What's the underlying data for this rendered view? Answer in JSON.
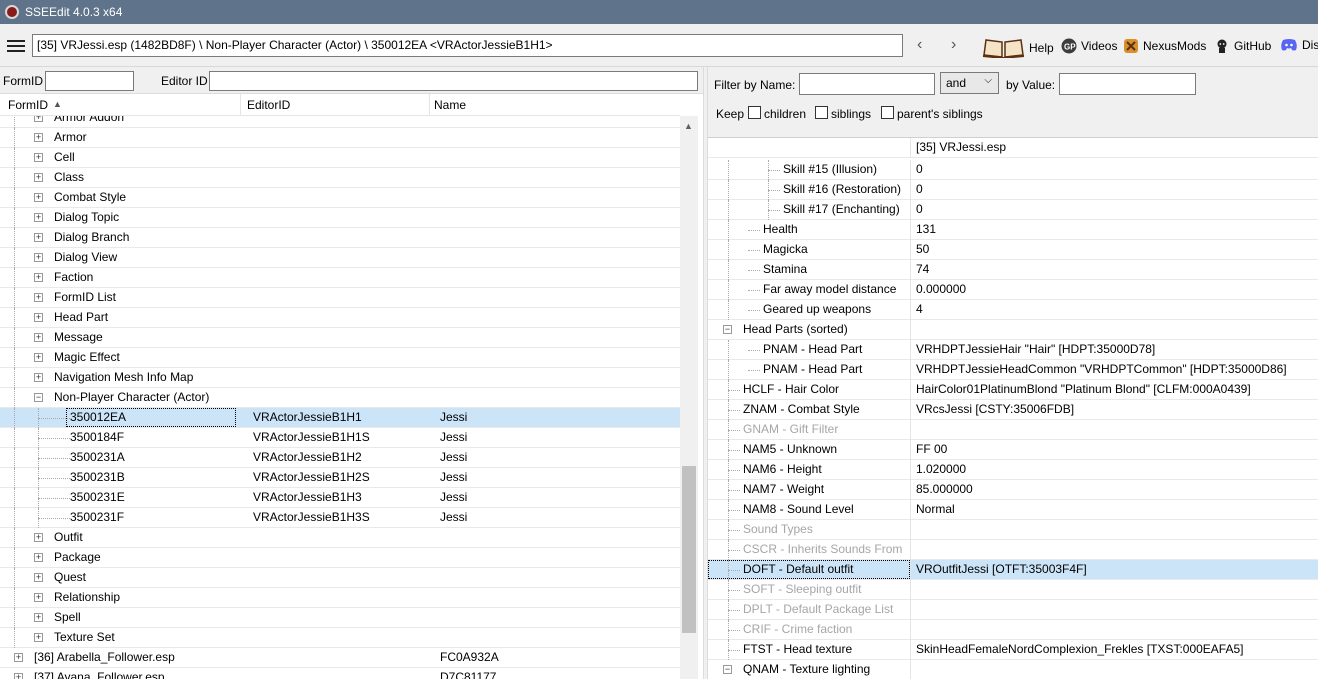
{
  "window": {
    "title": "SSEEdit 4.0.3 x64"
  },
  "toolbar": {
    "path": "[35] VRJessi.esp (1482BD8F) \\ Non-Player Character (Actor) \\ 350012EA <VRActorJessieB1H1>",
    "back_glyph": "‹",
    "forward_glyph": "›",
    "links": [
      {
        "label": "Help",
        "icon": "book-icon"
      },
      {
        "label": "Videos",
        "icon": "videos-icon"
      },
      {
        "label": "NexusMods",
        "icon": "nexusmods-icon"
      },
      {
        "label": "GitHub",
        "icon": "github-icon"
      },
      {
        "label": "Dis",
        "icon": "discord-icon"
      }
    ]
  },
  "left_filter": {
    "formid_label": "FormID",
    "editorid_label": "Editor ID",
    "formid_value": "",
    "editorid_value": ""
  },
  "tree": {
    "columns": [
      "FormID",
      "EditorID",
      "Name"
    ],
    "sort_glyph": "▲",
    "expand_glyph": "+",
    "collapse_glyph": "−",
    "rows": [
      {
        "formid": "Armor Addon",
        "editorid": "",
        "name": "",
        "level": 2,
        "expander": "+"
      },
      {
        "formid": "Armor",
        "editorid": "",
        "name": "",
        "level": 2,
        "expander": "+"
      },
      {
        "formid": "Cell",
        "editorid": "",
        "name": "",
        "level": 2,
        "expander": "+"
      },
      {
        "formid": "Class",
        "editorid": "",
        "name": "",
        "level": 2,
        "expander": "+"
      },
      {
        "formid": "Combat Style",
        "editorid": "",
        "name": "",
        "level": 2,
        "expander": "+"
      },
      {
        "formid": "Dialog Topic",
        "editorid": "",
        "name": "",
        "level": 2,
        "expander": "+"
      },
      {
        "formid": "Dialog Branch",
        "editorid": "",
        "name": "",
        "level": 2,
        "expander": "+"
      },
      {
        "formid": "Dialog View",
        "editorid": "",
        "name": "",
        "level": 2,
        "expander": "+"
      },
      {
        "formid": "Faction",
        "editorid": "",
        "name": "",
        "level": 2,
        "expander": "+"
      },
      {
        "formid": "FormID List",
        "editorid": "",
        "name": "",
        "level": 2,
        "expander": "+"
      },
      {
        "formid": "Head Part",
        "editorid": "",
        "name": "",
        "level": 2,
        "expander": "+"
      },
      {
        "formid": "Message",
        "editorid": "",
        "name": "",
        "level": 2,
        "expander": "+"
      },
      {
        "formid": "Magic Effect",
        "editorid": "",
        "name": "",
        "level": 2,
        "expander": "+"
      },
      {
        "formid": "Navigation Mesh Info Map",
        "editorid": "",
        "name": "",
        "level": 2,
        "expander": "+"
      },
      {
        "formid": "Non-Player Character (Actor)",
        "editorid": "",
        "name": "",
        "level": 2,
        "expander": "−"
      },
      {
        "formid": "350012EA",
        "editorid": "VRActorJessieB1H1",
        "name": "Jessi",
        "level": 3,
        "expander": "",
        "selected": true
      },
      {
        "formid": "3500184F",
        "editorid": "VRActorJessieB1H1S",
        "name": "Jessi",
        "level": 3,
        "expander": ""
      },
      {
        "formid": "3500231A",
        "editorid": "VRActorJessieB1H2",
        "name": "Jessi",
        "level": 3,
        "expander": ""
      },
      {
        "formid": "3500231B",
        "editorid": "VRActorJessieB1H2S",
        "name": "Jessi",
        "level": 3,
        "expander": ""
      },
      {
        "formid": "3500231E",
        "editorid": "VRActorJessieB1H3",
        "name": "Jessi",
        "level": 3,
        "expander": ""
      },
      {
        "formid": "3500231F",
        "editorid": "VRActorJessieB1H3S",
        "name": "Jessi",
        "level": 3,
        "expander": ""
      },
      {
        "formid": "Outfit",
        "editorid": "",
        "name": "",
        "level": 2,
        "expander": "+"
      },
      {
        "formid": "Package",
        "editorid": "",
        "name": "",
        "level": 2,
        "expander": "+"
      },
      {
        "formid": "Quest",
        "editorid": "",
        "name": "",
        "level": 2,
        "expander": "+"
      },
      {
        "formid": "Relationship",
        "editorid": "",
        "name": "",
        "level": 2,
        "expander": "+"
      },
      {
        "formid": "Spell",
        "editorid": "",
        "name": "",
        "level": 2,
        "expander": "+"
      },
      {
        "formid": "Texture Set",
        "editorid": "",
        "name": "",
        "level": 2,
        "expander": "+"
      },
      {
        "formid": "[36] Arabella_Follower.esp",
        "editorid": "",
        "name": "FC0A932A",
        "level": 1,
        "expander": "+"
      },
      {
        "formid": "[37] Ayana_Follower.esp",
        "editorid": "",
        "name": "D7C81177",
        "level": 1,
        "expander": "+"
      }
    ]
  },
  "right_filter": {
    "filter_by_name_label": "Filter by Name:",
    "name_value": "",
    "operator": "and",
    "by_value_label": "by Value:",
    "value_value": "",
    "keep_label": "Keep",
    "checkboxes": [
      "children",
      "siblings",
      "parent's siblings"
    ]
  },
  "record_view": {
    "header": "[35] VRJessi.esp",
    "rows": [
      {
        "label": "Skill #15 (Illusion)",
        "value": "0",
        "level": 3,
        "expander": "",
        "disabled": false
      },
      {
        "label": "Skill #16 (Restoration)",
        "value": "0",
        "level": 3,
        "expander": "",
        "disabled": false
      },
      {
        "label": "Skill #17 (Enchanting)",
        "value": "0",
        "level": 3,
        "expander": "",
        "disabled": false
      },
      {
        "label": "Health",
        "value": "131",
        "level": 2,
        "expander": "",
        "disabled": false
      },
      {
        "label": "Magicka",
        "value": "50",
        "level": 2,
        "expander": "",
        "disabled": false
      },
      {
        "label": "Stamina",
        "value": "74",
        "level": 2,
        "expander": "",
        "disabled": false
      },
      {
        "label": "Far away model distance",
        "value": "0.000000",
        "level": 2,
        "expander": "",
        "disabled": false
      },
      {
        "label": "Geared up weapons",
        "value": "4",
        "level": 2,
        "expander": "",
        "disabled": false
      },
      {
        "label": "Head Parts (sorted)",
        "value": "",
        "level": 1,
        "expander": "−",
        "disabled": false
      },
      {
        "label": "PNAM - Head Part",
        "value": "VRHDPTJessieHair \"Hair\" [HDPT:35000D78]",
        "level": 2,
        "expander": "",
        "disabled": false
      },
      {
        "label": "PNAM - Head Part",
        "value": "VRHDPTJessieHeadCommon \"VRHDPTCommon\" [HDPT:35000D86]",
        "level": 2,
        "expander": "",
        "disabled": false
      },
      {
        "label": "HCLF - Hair Color",
        "value": "HairColor01PlatinumBlond \"Platinum Blond\" [CLFM:000A0439]",
        "level": 1,
        "expander": "",
        "disabled": false
      },
      {
        "label": "ZNAM - Combat Style",
        "value": "VRcsJessi [CSTY:35006FDB]",
        "level": 1,
        "expander": "",
        "disabled": false
      },
      {
        "label": "GNAM - Gift Filter",
        "value": "",
        "level": 1,
        "expander": "",
        "disabled": true
      },
      {
        "label": "NAM5 - Unknown",
        "value": "FF 00",
        "level": 1,
        "expander": "",
        "disabled": false
      },
      {
        "label": "NAM6 - Height",
        "value": "1.020000",
        "level": 1,
        "expander": "",
        "disabled": false
      },
      {
        "label": "NAM7 - Weight",
        "value": "85.000000",
        "level": 1,
        "expander": "",
        "disabled": false
      },
      {
        "label": "NAM8 - Sound Level",
        "value": "Normal",
        "level": 1,
        "expander": "",
        "disabled": false
      },
      {
        "label": "Sound Types",
        "value": "",
        "level": 1,
        "expander": "",
        "disabled": true
      },
      {
        "label": "CSCR - Inherits Sounds From",
        "value": "",
        "level": 1,
        "expander": "",
        "disabled": true
      },
      {
        "label": "DOFT - Default outfit",
        "value": "VROutfitJessi [OTFT:35003F4F]",
        "level": 1,
        "expander": "",
        "disabled": false,
        "selected": true
      },
      {
        "label": "SOFT - Sleeping outfit",
        "value": "",
        "level": 1,
        "expander": "",
        "disabled": true
      },
      {
        "label": "DPLT - Default Package List",
        "value": "",
        "level": 1,
        "expander": "",
        "disabled": true
      },
      {
        "label": "CRIF - Crime faction",
        "value": "",
        "level": 1,
        "expander": "",
        "disabled": true
      },
      {
        "label": "FTST - Head texture",
        "value": "SkinHeadFemaleNordComplexion_Frekles [TXST:000EAFA5]",
        "level": 1,
        "expander": "",
        "disabled": false
      },
      {
        "label": "QNAM - Texture lighting",
        "value": "",
        "level": 1,
        "expander": "−",
        "disabled": false
      }
    ]
  },
  "colors": {
    "titlebar": "#5f738a",
    "selection": "#cce4f7",
    "disabled_text": "#a6a6a6"
  }
}
